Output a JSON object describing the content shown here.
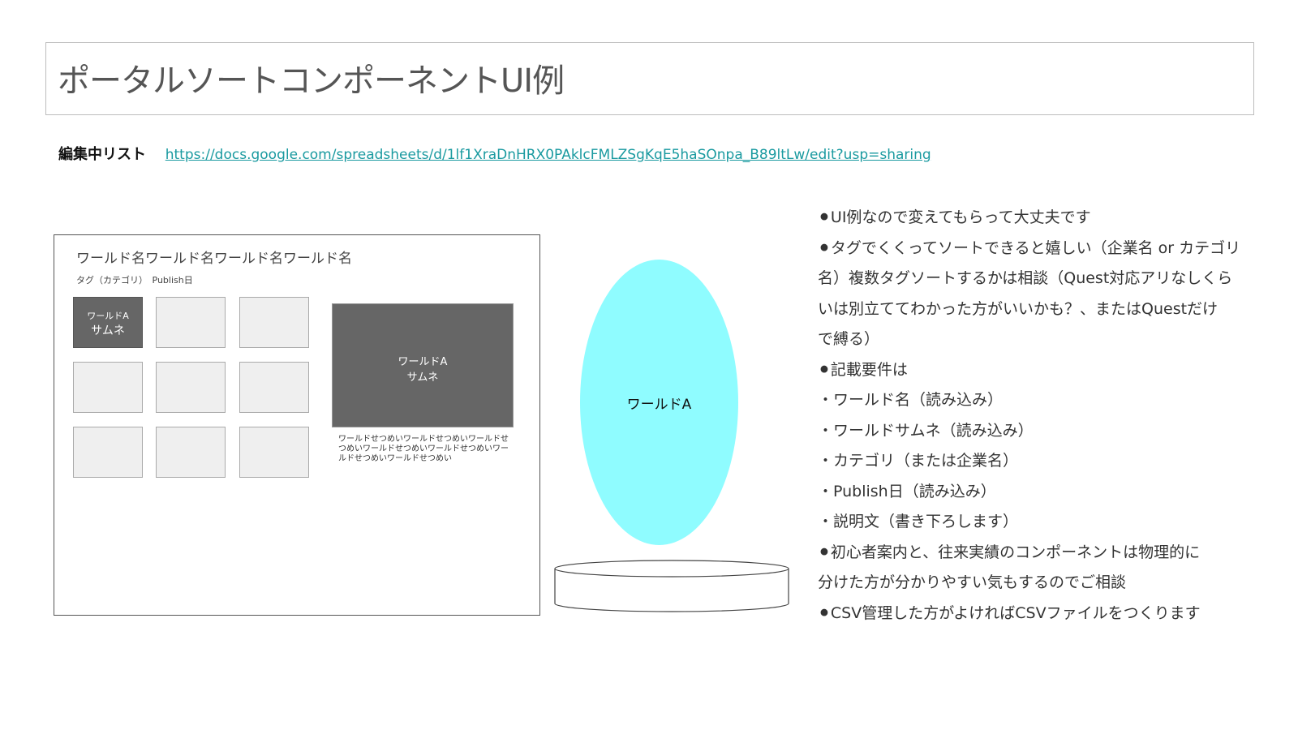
{
  "title": "ポータルソートコンポーネントUI例",
  "edit_list": {
    "label": "編集中リスト",
    "url": "https://docs.google.com/spreadsheets/d/1lf1XraDnHRX0PAklcFMLZSgKqE5haSOnpa_B89ltLw/edit?usp=sharing"
  },
  "portal": {
    "world_title": "ワールド名ワールド名ワールド名ワールド名",
    "meta": "タグ（カテゴリ）　Publish日",
    "thumb_small": {
      "line1": "ワールドA",
      "line2": "サムネ"
    },
    "preview": {
      "line1": "ワールドA",
      "line2": "サムネ"
    },
    "description": "ワールドせつめいワールドせつめいワールドせつめいワールドせつめいワールドせつめいワールドせつめいワールドせつめい"
  },
  "portal_object": {
    "label": "ワールドA",
    "color": "#8ffcff"
  },
  "notes": [
    "⚫UI例なので変えてもらって大丈夫です",
    "⚫タグでくくってソートできると嬉しい（企業名 or カテゴリ",
    "名）複数タグソートするかは相談（Quest対応アリなしくら",
    "いは別立ててわかった方がいいかも？、またはQuestだけ",
    "で縛る）",
    "⚫記載要件は",
    "・ワールド名（読み込み）",
    "・ワールドサムネ（読み込み）",
    "・カテゴリ（または企業名）",
    "・Publish日（読み込み）",
    "・説明文（書き下ろします）",
    "⚫初心者案内と、往来実績のコンポーネントは物理的に",
    "分けた方が分かりやすい気もするのでご相談",
    "⚫CSV管理した方がよければCSVファイルをつくります"
  ]
}
